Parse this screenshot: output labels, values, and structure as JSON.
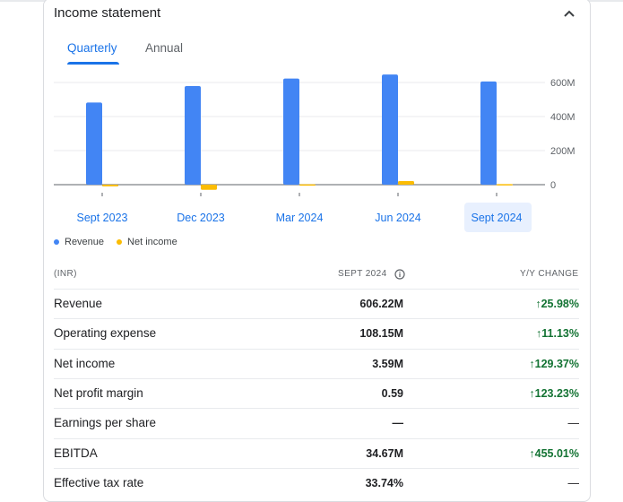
{
  "header": {
    "title": "Income statement"
  },
  "tabs": [
    {
      "label": "Quarterly",
      "active": true
    },
    {
      "label": "Annual",
      "active": false
    }
  ],
  "chart_data": {
    "type": "bar",
    "categories": [
      "Sept 2023",
      "Dec 2023",
      "Mar 2024",
      "Jun 2024",
      "Sept 2024"
    ],
    "series": [
      {
        "name": "Revenue",
        "color": "#4285f4",
        "values": [
          482,
          579,
          623,
          647,
          606.22
        ]
      },
      {
        "name": "Net income",
        "color": "#fbbc04",
        "values": [
          -10,
          -30,
          2,
          21,
          3.59
        ]
      }
    ],
    "y_ticks": [
      {
        "value": 600,
        "label": "600M"
      },
      {
        "value": 400,
        "label": "400M"
      },
      {
        "value": 200,
        "label": "200M"
      },
      {
        "value": 0,
        "label": "0"
      }
    ],
    "ylim": [
      -40,
      640
    ],
    "highlighted_category": "Sept 2024",
    "grid": true,
    "legend_position": "bottom-left"
  },
  "table": {
    "headers": {
      "currency": "(INR)",
      "period": "SEPT 2024",
      "change": "Y/Y CHANGE"
    },
    "rows": [
      {
        "name": "Revenue",
        "value": "606.22M",
        "change": "25.98%",
        "trend": "up"
      },
      {
        "name": "Operating expense",
        "value": "108.15M",
        "change": "11.13%",
        "trend": "up"
      },
      {
        "name": "Net income",
        "value": "3.59M",
        "change": "129.37%",
        "trend": "up"
      },
      {
        "name": "Net profit margin",
        "value": "0.59",
        "change": "123.23%",
        "trend": "up"
      },
      {
        "name": "Earnings per share",
        "value": "—",
        "change": "—",
        "trend": "none"
      },
      {
        "name": "EBITDA",
        "value": "34.67M",
        "change": "455.01%",
        "trend": "up"
      },
      {
        "name": "Effective tax rate",
        "value": "33.74%",
        "change": "—",
        "trend": "none"
      }
    ]
  }
}
